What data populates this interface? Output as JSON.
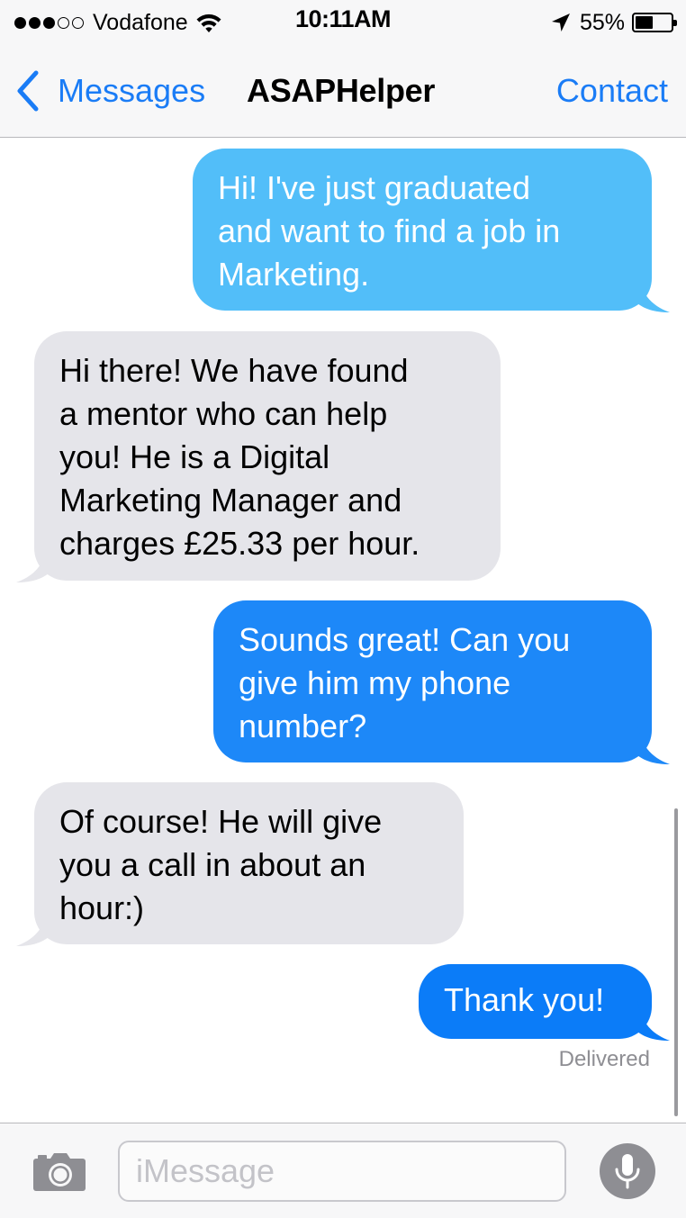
{
  "status_bar": {
    "signal_bars_filled": 3,
    "signal_bars_total": 5,
    "carrier": "Vodafone",
    "time": "10:11AM",
    "battery_percent_label": "55%",
    "battery_level": 0.55,
    "icons": [
      "wifi-icon",
      "location-arrow-icon",
      "battery-icon"
    ]
  },
  "nav": {
    "back_label": "Messages",
    "title": "ASAPHelper",
    "contact_label": "Contact"
  },
  "conversation": {
    "messages": [
      {
        "direction": "outgoing",
        "text": "Hi! I've just graduated\nand want to find a job in\nMarketing."
      },
      {
        "direction": "incoming",
        "text": "Hi there! We have found\na mentor who can help\nyou! He is a Digital\nMarketing Manager and\ncharges £25.33 per hour."
      },
      {
        "direction": "outgoing",
        "text": "Sounds great! Can you\ngive him my phone\nnumber?"
      },
      {
        "direction": "incoming",
        "text": "Of course! He will give\nyou a call in about an\nhour:)"
      },
      {
        "direction": "outgoing",
        "text": "Thank you!"
      }
    ],
    "delivery_status": "Delivered"
  },
  "composer": {
    "placeholder": "iMessage",
    "value": "",
    "icons": [
      "camera-icon",
      "microphone-icon"
    ]
  },
  "colors": {
    "accent": "#1a7cf6",
    "outgoing_bubbles": [
      "#52bef9",
      "#1d88f8",
      "#0b7cf8"
    ],
    "incoming_bubble": "#e5e5ea",
    "bar_background": "#f7f7f8"
  }
}
